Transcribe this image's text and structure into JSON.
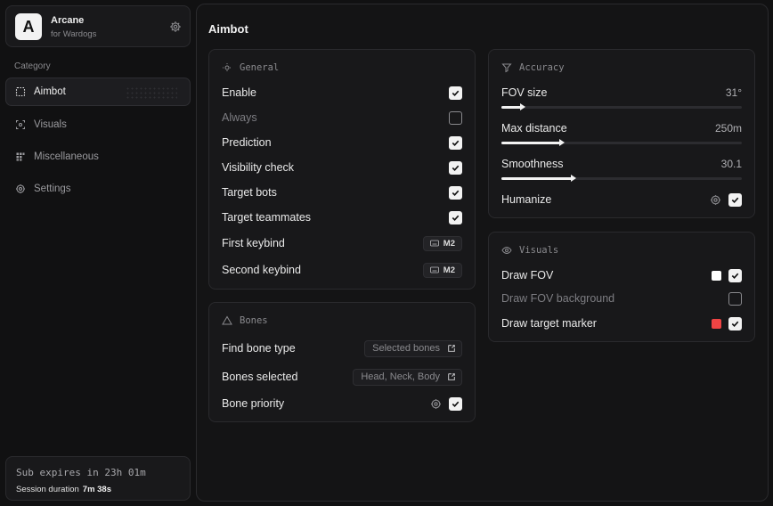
{
  "brand": {
    "logo_letter": "A",
    "name": "Arcane",
    "subtitle": "for Wardogs"
  },
  "sidebar": {
    "category_title": "Category",
    "items": [
      {
        "label": "Aimbot",
        "icon": "crosshair-dashed-icon",
        "active": true
      },
      {
        "label": "Visuals",
        "icon": "scan-eye-icon",
        "active": false
      },
      {
        "label": "Miscellaneous",
        "icon": "grid-icon",
        "active": false
      },
      {
        "label": "Settings",
        "icon": "gear-icon",
        "active": false
      }
    ]
  },
  "footer": {
    "sub_expires": "Sub expires in 23h 01m",
    "session_label": "Session duration",
    "session_value": "7m 38s"
  },
  "main": {
    "title": "Aimbot"
  },
  "general": {
    "title": "General",
    "rows": [
      {
        "label": "Enable",
        "checked": true
      },
      {
        "label": "Always",
        "checked": false
      },
      {
        "label": "Prediction",
        "checked": true
      },
      {
        "label": "Visibility check",
        "checked": true
      },
      {
        "label": "Target bots",
        "checked": true
      },
      {
        "label": "Target teammates",
        "checked": true
      }
    ],
    "keybinds": [
      {
        "label": "First keybind",
        "key": "M2"
      },
      {
        "label": "Second keybind",
        "key": "M2"
      }
    ]
  },
  "bones": {
    "title": "Bones",
    "find_label": "Find bone type",
    "find_value": "Selected bones",
    "selected_label": "Bones selected",
    "selected_value": "Head, Neck, Body",
    "priority_label": "Bone priority",
    "priority_checked": true
  },
  "accuracy": {
    "title": "Accuracy",
    "sliders": [
      {
        "label": "FOV size",
        "value": "31°",
        "fraction": 0.09
      },
      {
        "label": "Max distance",
        "value": "250m",
        "fraction": 0.25
      },
      {
        "label": "Smoothness",
        "value": "30.1",
        "fraction": 0.3
      }
    ],
    "humanize_label": "Humanize",
    "humanize_checked": true
  },
  "visuals": {
    "title": "Visuals",
    "draw_fov_label": "Draw FOV",
    "draw_fov_color": "#ffffff",
    "draw_fov_bg_label": "Draw FOV background",
    "draw_marker_label": "Draw target marker",
    "draw_marker_color": "#ef4444"
  }
}
